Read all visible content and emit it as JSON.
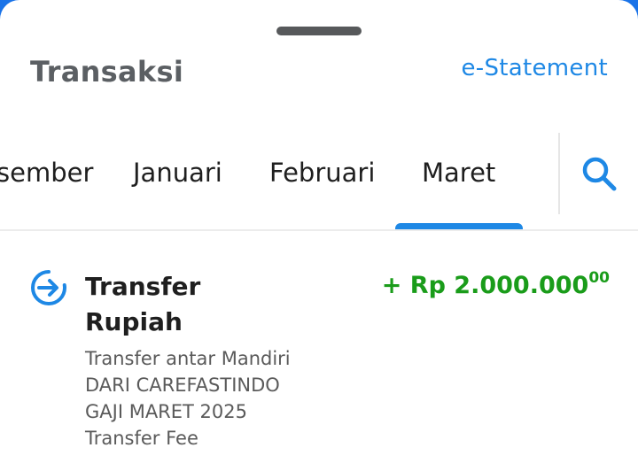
{
  "header": {
    "title": "Transaksi",
    "estatement_link": "e-Statement"
  },
  "month_tabs": [
    {
      "label": "Desember",
      "visible_text": "sember",
      "selected": false
    },
    {
      "label": "Januari",
      "visible_text": "Januari",
      "selected": false
    },
    {
      "label": "Februari",
      "visible_text": "Februari",
      "selected": false
    },
    {
      "label": "Maret",
      "visible_text": "Maret",
      "selected": true
    }
  ],
  "search": {
    "icon": "search-icon"
  },
  "transactions": [
    {
      "icon": "transfer-in-icon",
      "title_line1": "Transfer",
      "title_line2": "Rupiah",
      "amount_main": "+ Rp 2.000.000",
      "amount_cents": "00",
      "details": [
        "Transfer antar Mandiri",
        "DARI CAREFASTINDO",
        "GAJI MARET 2025",
        "Transfer Fee"
      ]
    }
  ],
  "colors": {
    "accent": "#1e88e5",
    "amount_positive": "#1a9c1a",
    "title_text": "#5b5f63"
  }
}
